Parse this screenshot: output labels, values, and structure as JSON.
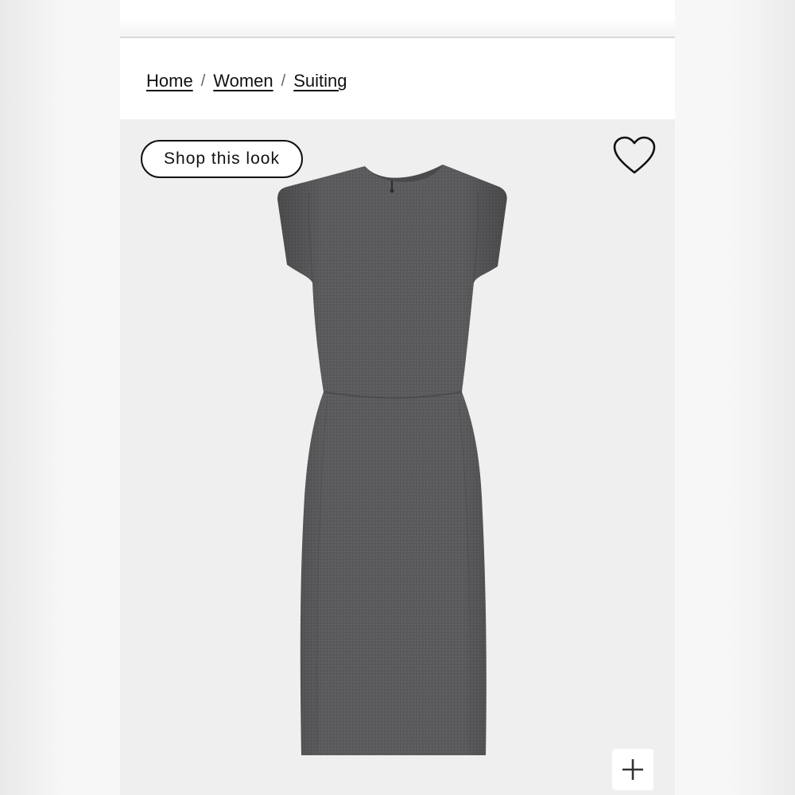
{
  "breadcrumb": {
    "items": [
      {
        "label": "Home"
      },
      {
        "label": "Women"
      },
      {
        "label": "Suiting"
      }
    ],
    "separator": "/"
  },
  "product": {
    "shop_look_label": "Shop this look",
    "favorite_icon": "heart-outline-icon",
    "zoom_icon": "plus-icon",
    "image": "gray cap-sleeve sheath dress",
    "dress_color": "#5b5b5d",
    "image_background": "#efefef"
  }
}
